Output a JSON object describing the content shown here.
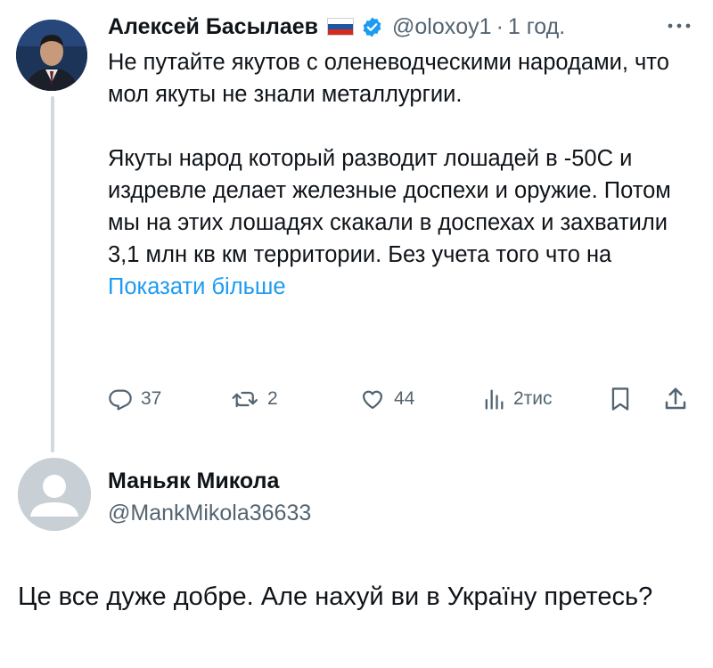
{
  "tweet": {
    "author_name": "Алексей Басылаев",
    "handle": "@oloxoy1",
    "separator": "·",
    "time": "1 год.",
    "paragraph1": "Не путайте якутов с оленеводческими народами, что мол якуты не знали металлургии.",
    "paragraph2": "Якуты народ который разводит лошадей в -50С и издревле делает железные доспехи и оружие. Потом мы на этих лошадях скакали в доспехах и захватили 3,1 млн кв км территории. Без учета того что  на ",
    "show_more": "Показати більше",
    "actions": {
      "replies": "37",
      "retweets": "2",
      "likes": "44",
      "views": "2тис"
    }
  },
  "reply": {
    "author_name": "Маньяк Микола",
    "handle": "@MankMikola36633",
    "text": "Це все дуже добре. Але нахуй ви в Україну претесь?"
  },
  "colors": {
    "text": "#0f1419",
    "secondary": "#536471",
    "accent": "#1d9bf0",
    "thread_line": "#cfd9de"
  },
  "icons": [
    "flag-russia-icon",
    "verified-badge-icon",
    "more-options-icon",
    "reply-icon",
    "retweet-icon",
    "like-icon",
    "views-icon",
    "bookmark-icon",
    "share-icon"
  ]
}
